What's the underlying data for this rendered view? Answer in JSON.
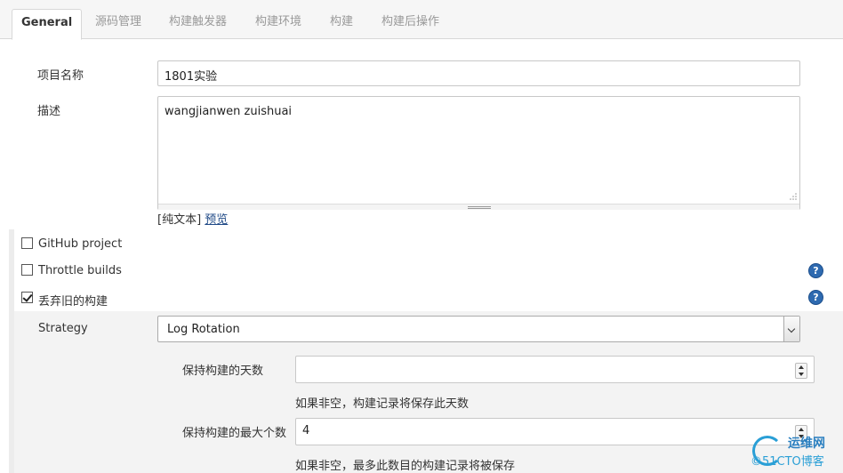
{
  "tabs": [
    {
      "label": "General",
      "active": true
    },
    {
      "label": "源码管理",
      "active": false
    },
    {
      "label": "构建触发器",
      "active": false
    },
    {
      "label": "构建环境",
      "active": false
    },
    {
      "label": "构建",
      "active": false
    },
    {
      "label": "构建后操作",
      "active": false
    }
  ],
  "project_name": {
    "label": "项目名称",
    "value": "1801实验"
  },
  "description": {
    "label": "描述",
    "value": "wangjianwen zuishuai"
  },
  "format": {
    "plain_text": "[纯文本]",
    "preview_link": "预览"
  },
  "options": {
    "github_project": {
      "label": "GitHub project",
      "checked": false
    },
    "throttle_builds": {
      "label": "Throttle builds",
      "checked": false
    },
    "discard_old_builds": {
      "label": "丢弃旧的构建",
      "checked": true
    }
  },
  "help_icon_text": "?",
  "strategy": {
    "label": "Strategy",
    "selected": "Log Rotation",
    "days_to_keep": {
      "label": "保持构建的天数",
      "value": "",
      "hint": "如果非空，构建记录将保存此天数"
    },
    "max_builds": {
      "label": "保持构建的最大个数",
      "value": "4",
      "hint": "如果非空，最多此数目的构建记录将被保存"
    }
  },
  "watermark": {
    "line1": "运维网",
    "line2": "©51CTO博客"
  },
  "colors": {
    "accent": "#2e6ab0",
    "link": "#204a87",
    "tab_inactive": "#999999"
  }
}
